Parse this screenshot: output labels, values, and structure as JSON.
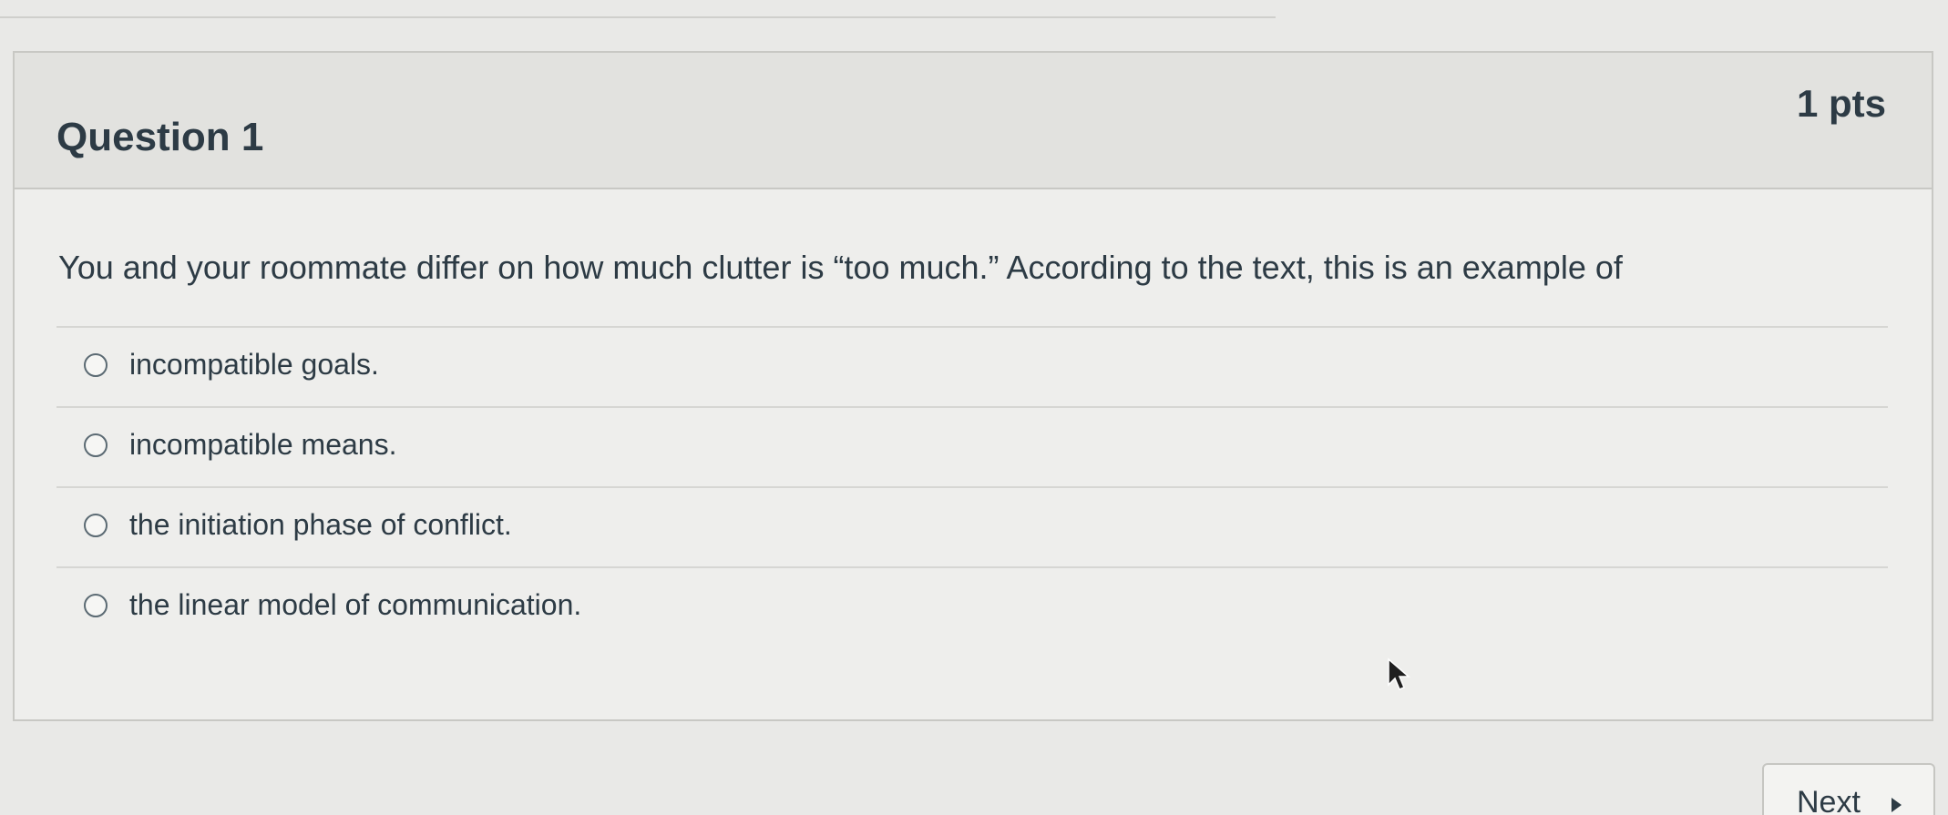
{
  "question": {
    "title": "Question 1",
    "points": "1 pts",
    "text": "You and your roommate differ on how much clutter is “too much.” According to the text, this is an example of"
  },
  "answers": [
    {
      "label": "incompatible goals.",
      "selected": false
    },
    {
      "label": "incompatible means.",
      "selected": false
    },
    {
      "label": "the initiation phase of conflict.",
      "selected": false
    },
    {
      "label": "the linear model of communication.",
      "selected": false
    }
  ],
  "navigation": {
    "next_label": "Next",
    "next_icon": "triangle-right-icon"
  },
  "cursor": {
    "icon": "mouse-pointer-icon"
  },
  "colors": {
    "background": "#e9e9e7",
    "header_background": "#e2e2df",
    "text": "#2d3b45",
    "border": "#c8c8c4"
  }
}
